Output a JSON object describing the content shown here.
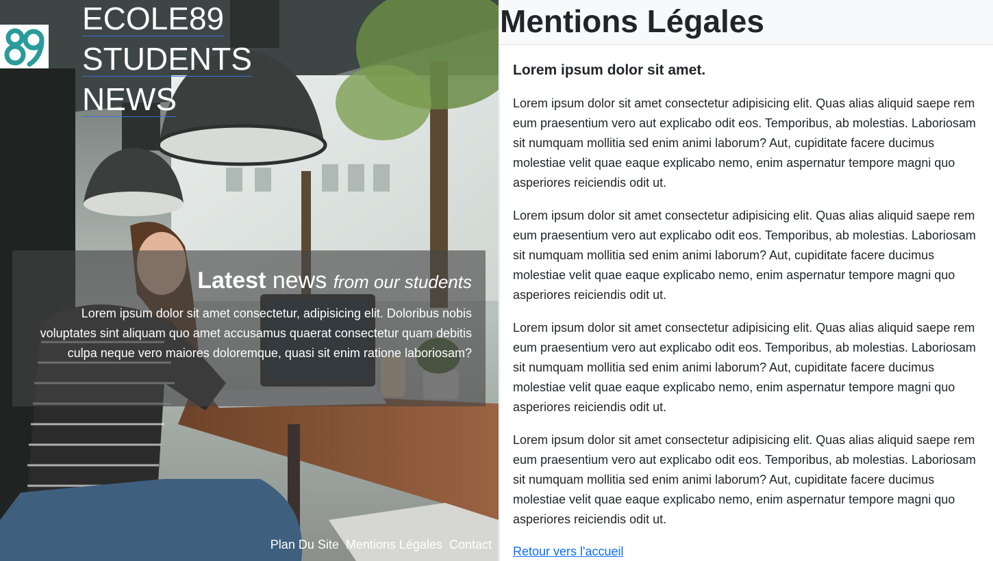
{
  "hero": {
    "logo_text": "89",
    "brand_lines": [
      "ECOLE89",
      "STUDENTS",
      "NEWS"
    ],
    "intro": {
      "title_strong": "Latest",
      "title_normal": "news",
      "title_italic": "from our students",
      "text": "Lorem ipsum dolor sit amet consectetur, adipisicing elit. Doloribus nobis voluptates sint aliquam quo amet accusamus quaerat consectetur quam debitis culpa neque vero maiores doloremque, quasi sit enim ratione laboriosam?"
    },
    "footer_links": [
      "Plan Du Site",
      "Mentions Légales",
      "Contact"
    ]
  },
  "main": {
    "page_title": "Mentions Légales",
    "section_title": "Lorem ipsum dolor sit amet.",
    "paragraphs": [
      "Lorem ipsum dolor sit amet consectetur adipisicing elit. Quas alias aliquid saepe rem eum praesentium vero aut explicabo odit eos. Temporibus, ab molestias. Laboriosam sit numquam mollitia sed enim animi laborum? Aut, cupiditate facere ducimus molestiae velit quae eaque explicabo nemo, enim aspernatur tempore magni quo asperiores reiciendis odit ut.",
      "Lorem ipsum dolor sit amet consectetur adipisicing elit. Quas alias aliquid saepe rem eum praesentium vero aut explicabo odit eos. Temporibus, ab molestias. Laboriosam sit numquam mollitia sed enim animi laborum? Aut, cupiditate facere ducimus molestiae velit quae eaque explicabo nemo, enim aspernatur tempore magni quo asperiores reiciendis odit ut.",
      "Lorem ipsum dolor sit amet consectetur adipisicing elit. Quas alias aliquid saepe rem eum praesentium vero aut explicabo odit eos. Temporibus, ab molestias. Laboriosam sit numquam mollitia sed enim animi laborum? Aut, cupiditate facere ducimus molestiae velit quae eaque explicabo nemo, enim aspernatur tempore magni quo asperiores reiciendis odit ut.",
      "Lorem ipsum dolor sit amet consectetur adipisicing elit. Quas alias aliquid saepe rem eum praesentium vero aut explicabo odit eos. Temporibus, ab molestias. Laboriosam sit numquam mollitia sed enim animi laborum? Aut, cupiditate facere ducimus molestiae velit quae eaque explicabo nemo, enim aspernatur tempore magni quo asperiores reiciendis odit ut."
    ],
    "back_link": "Retour vers l'accueil"
  },
  "colors": {
    "logo_teal": "#2a9a9a",
    "link_blue": "#0d6efd",
    "header_bg": "#f8f9fa",
    "text_dark": "#212529"
  },
  "icons": {
    "logo": "ecole89-logo-icon"
  }
}
